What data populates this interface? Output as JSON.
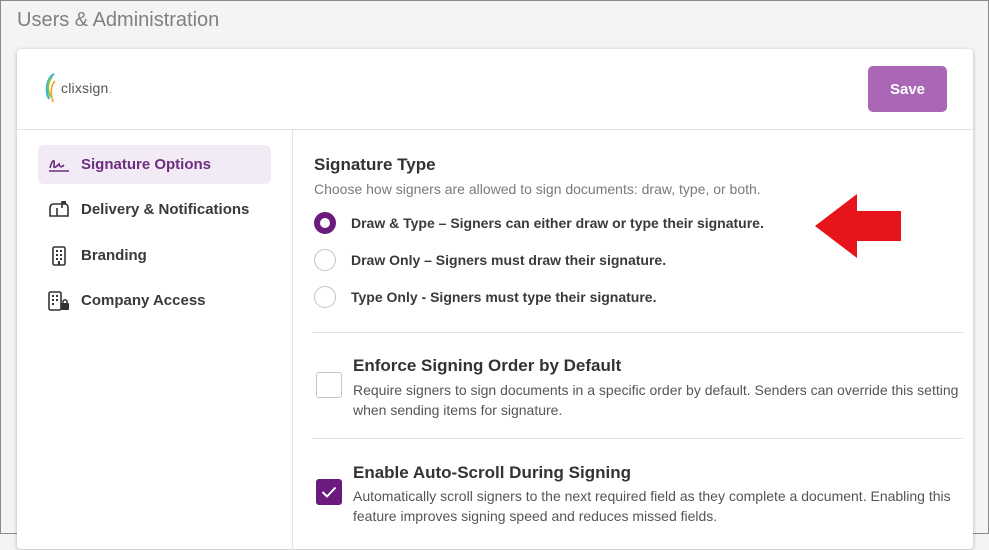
{
  "page": {
    "title": "Users & Administration"
  },
  "header": {
    "logo_text": "clixsign",
    "logo_mark": ".",
    "save_label": "Save"
  },
  "sidebar": {
    "items": [
      {
        "label": "Signature Options",
        "icon": "signature-icon",
        "active": true
      },
      {
        "label": "Delivery & Notifications",
        "icon": "mailbox-icon",
        "active": false
      },
      {
        "label": "Branding",
        "icon": "building-icon",
        "active": false
      },
      {
        "label": "Company Access",
        "icon": "building-lock-icon",
        "active": false
      }
    ]
  },
  "signature_type": {
    "title": "Signature Type",
    "description": "Choose how signers are allowed to sign documents: draw, type, or both.",
    "options": [
      {
        "label": "Draw & Type – Signers can either draw or type their signature.",
        "selected": true
      },
      {
        "label": "Draw Only – Signers must draw their signature.",
        "selected": false
      },
      {
        "label": "Type Only - Signers must type their signature.",
        "selected": false
      }
    ]
  },
  "settings": [
    {
      "title": "Enforce Signing Order by Default",
      "description": "Require signers to sign documents in a specific order by default. Senders can override this setting when sending items for signature.",
      "checked": false
    },
    {
      "title": "Enable Auto-Scroll During Signing",
      "description": "Automatically scroll signers to the next required field as they complete a document. Enabling this feature improves signing speed and reduces missed fields.",
      "checked": true
    }
  ],
  "colors": {
    "accent": "#6b1a7d",
    "save_button": "#a967b5",
    "active_nav_bg": "#f2ebf5",
    "annotation_arrow": "#e8141b"
  }
}
